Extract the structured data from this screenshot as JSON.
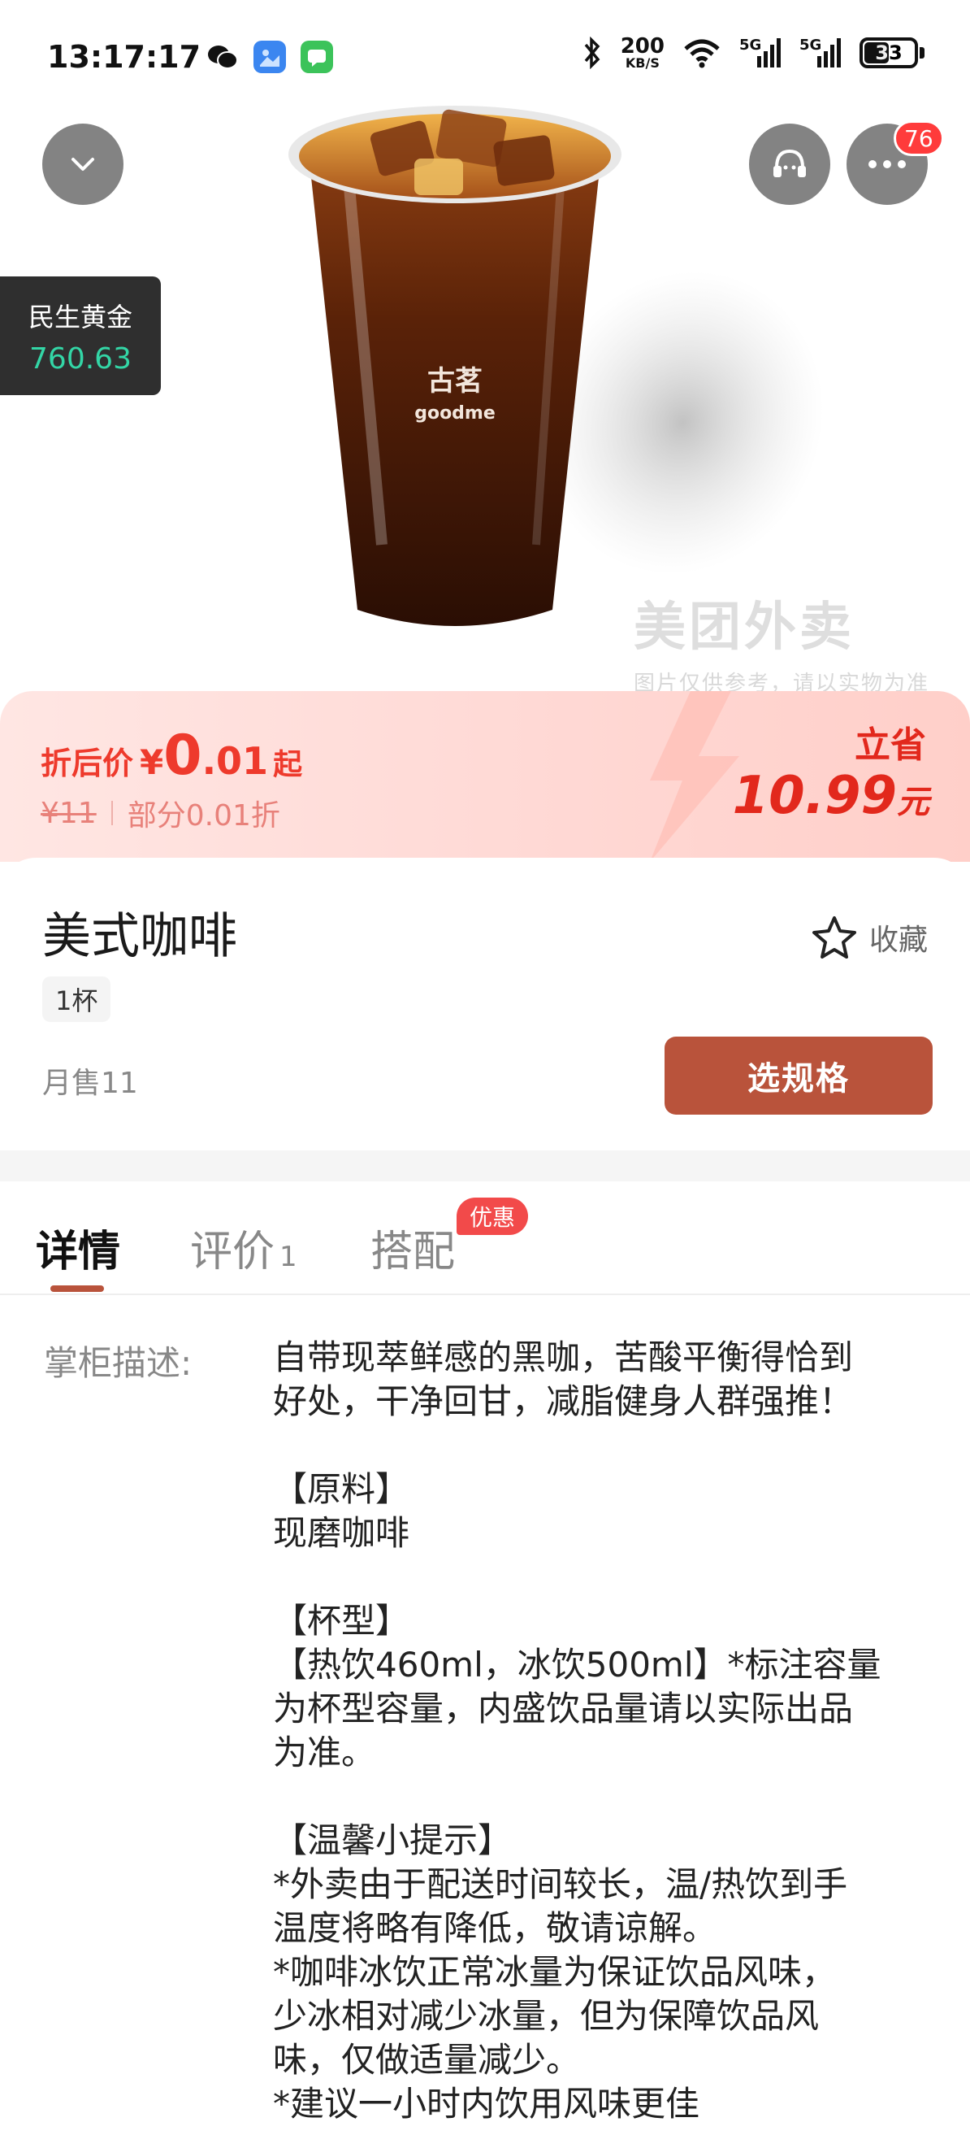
{
  "status_bar": {
    "time": "13:17:17",
    "net_speed_value": "200",
    "net_speed_unit": "KB/S",
    "signal_1": "5G",
    "signal_2": "5G",
    "battery": "33"
  },
  "header": {
    "notification_count": "76"
  },
  "gold_widget": {
    "title": "民生黄金",
    "value": "760.63"
  },
  "hero": {
    "cup_brand_cn": "古茗",
    "cup_brand_en": "goodme",
    "watermark": "美团外卖",
    "watermark_note": "图片仅供参考，请以实物为准"
  },
  "price": {
    "label": "折后价",
    "currency": "¥",
    "int_part": "0",
    "dec_part": ".01",
    "suffix": "起",
    "original": "¥11",
    "discount_note": "部分0.01折",
    "save_label": "立省",
    "save_amount": "10.99",
    "save_unit": "元"
  },
  "product": {
    "name": "美式咖啡",
    "unit_tag": "1杯",
    "favorite_label": "收藏",
    "monthly_sales": "月售11",
    "select_spec_label": "选规格"
  },
  "tabs": [
    {
      "label": "详情",
      "count": ""
    },
    {
      "label": "评价",
      "count": "1"
    },
    {
      "label": "搭配",
      "count": ""
    }
  ],
  "promo_badge": "优惠",
  "description": {
    "label": "掌柜描述:",
    "lines": [
      "自带现萃鲜感的黑咖，苦酸平衡得恰到",
      "好处，干净回甘，减脂健身人群强推！",
      "",
      "【原料】",
      "现磨咖啡",
      "",
      "【杯型】",
      "【热饮460ml，冰饮500ml】*标注容量",
      "为杯型容量，内盛饮品量请以实际出品",
      "为准。",
      "",
      "【温馨小提示】",
      "*外卖由于配送时间较长，温/热饮到手",
      "温度将略有降低，敬请谅解。",
      "*咖啡冰饮正常冰量为保证饮品风味，",
      "少冰相对减少冰量，但为保障饮品风",
      "味，仅做适量减少。",
      "*建议一小时内饮用风味更佳"
    ]
  },
  "colors": {
    "accent": "#b9533b",
    "price_red": "#ee3a2c",
    "badge_red": "#ff3b3b",
    "gold_green": "#33d6a6"
  }
}
